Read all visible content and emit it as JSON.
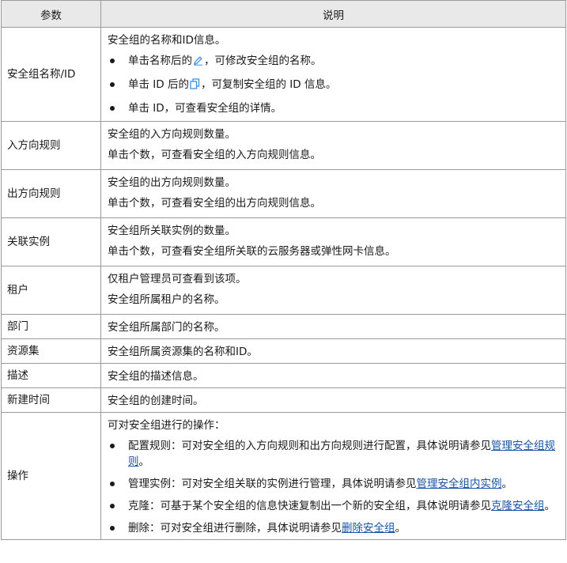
{
  "table": {
    "header": {
      "param": "参数",
      "desc": "说明"
    },
    "rows": {
      "name": {
        "param": "安全组名称/ID",
        "intro": "安全组的名称和ID信息。",
        "b1_pre": "单击名称后的",
        "b1_post": "，可修改安全组的名称。",
        "b2_pre": "单击 ID 后的",
        "b2_post": "，可复制安全组的 ID 信息。",
        "b3": "单击 ID，可查看安全组的详情。"
      },
      "inbound": {
        "param": "入方向规则",
        "line1": "安全组的入方向规则数量。",
        "line2": "单击个数，可查看安全组的入方向规则信息。"
      },
      "outbound": {
        "param": "出方向规则",
        "line1": "安全组的出方向规则数量。",
        "line2": "单击个数，可查看安全组的出方向规则信息。"
      },
      "instances": {
        "param": "关联实例",
        "line1": "安全组所关联实例的数量。",
        "line2": "单击个数，可查看安全组所关联的云服务器或弹性网卡信息。"
      },
      "tenant": {
        "param": "租户",
        "line1": "仅租户管理员可查看到该项。",
        "line2": "安全组所属租户的名称。"
      },
      "department": {
        "param": "部门",
        "line1": "安全组所属部门的名称。"
      },
      "resource_set": {
        "param": "资源集",
        "line1": "安全组所属资源集的名称和ID。"
      },
      "description": {
        "param": "描述",
        "line1": "安全组的描述信息。"
      },
      "created": {
        "param": "新建时间",
        "line1": "安全组的创建时间。"
      },
      "operations": {
        "param": "操作",
        "intro": "可对安全组进行的操作：",
        "b1_text": "配置规则：可对安全组的入方向规则和出方向规则进行配置，具体说明请参见",
        "b1_link": "管理安全组规则",
        "b1_end": "。",
        "b2_text": "管理实例：可对安全组关联的实例进行管理，具体说明请参见",
        "b2_link": "管理安全组内实例",
        "b2_end": "。",
        "b3_text": "克隆：可基于某个安全组的信息快速复制出一个新的安全组，具体说明请参见",
        "b3_link": "克隆安全组",
        "b3_end": "。",
        "b4_text": "删除：可对安全组进行删除，具体说明请参见",
        "b4_link": "删除安全组",
        "b4_end": "。"
      }
    }
  },
  "icons": {
    "edit": "edit-pencil-icon",
    "copy": "copy-icon"
  },
  "colors": {
    "header_bg": "#e9e9e9",
    "border": "#9a9a9a",
    "link": "#1a55a6",
    "icon": "#3a8ee6"
  }
}
